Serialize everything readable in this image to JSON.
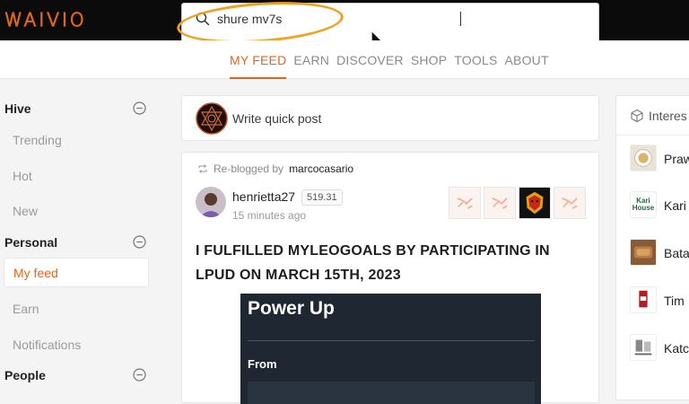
{
  "header": {
    "logo": "WAIVIO",
    "search": {
      "value": "shure mv7s"
    }
  },
  "nav": {
    "tabs": [
      {
        "label": "MY FEED",
        "active": true
      },
      {
        "label": "EARN"
      },
      {
        "label": "DISCOVER"
      },
      {
        "label": "SHOP"
      },
      {
        "label": "TOOLS"
      },
      {
        "label": "ABOUT"
      }
    ]
  },
  "sidebar": {
    "hive": {
      "title": "Hive",
      "items": [
        "Trending",
        "Hot",
        "New"
      ]
    },
    "personal": {
      "title": "Personal",
      "items": [
        "My feed",
        "Earn",
        "Notifications"
      ]
    },
    "people": {
      "title": "People"
    }
  },
  "quick_post": {
    "label": "Write quick post"
  },
  "post": {
    "reblog_prefix": "Re-blogged by",
    "reblog_user": "marcocasario",
    "author": "henrietta27",
    "reputation": "519.31",
    "time": "15 minutes ago",
    "title": "I FULFILLED MYLEOGOALS BY PARTICIPATING IN LPUD ON MARCH 15TH, 2023",
    "image": {
      "title": "Power Up",
      "label": "From"
    }
  },
  "right_sidebar": {
    "header": "Interes",
    "items": [
      "Praw",
      "Kari",
      "Batar",
      "Tim",
      "Katc"
    ],
    "kari_logo_text": "Kari House"
  },
  "colors": {
    "accent": "#e0661d",
    "highlight": "#f0a023",
    "topbar": "#0b0b0b"
  }
}
